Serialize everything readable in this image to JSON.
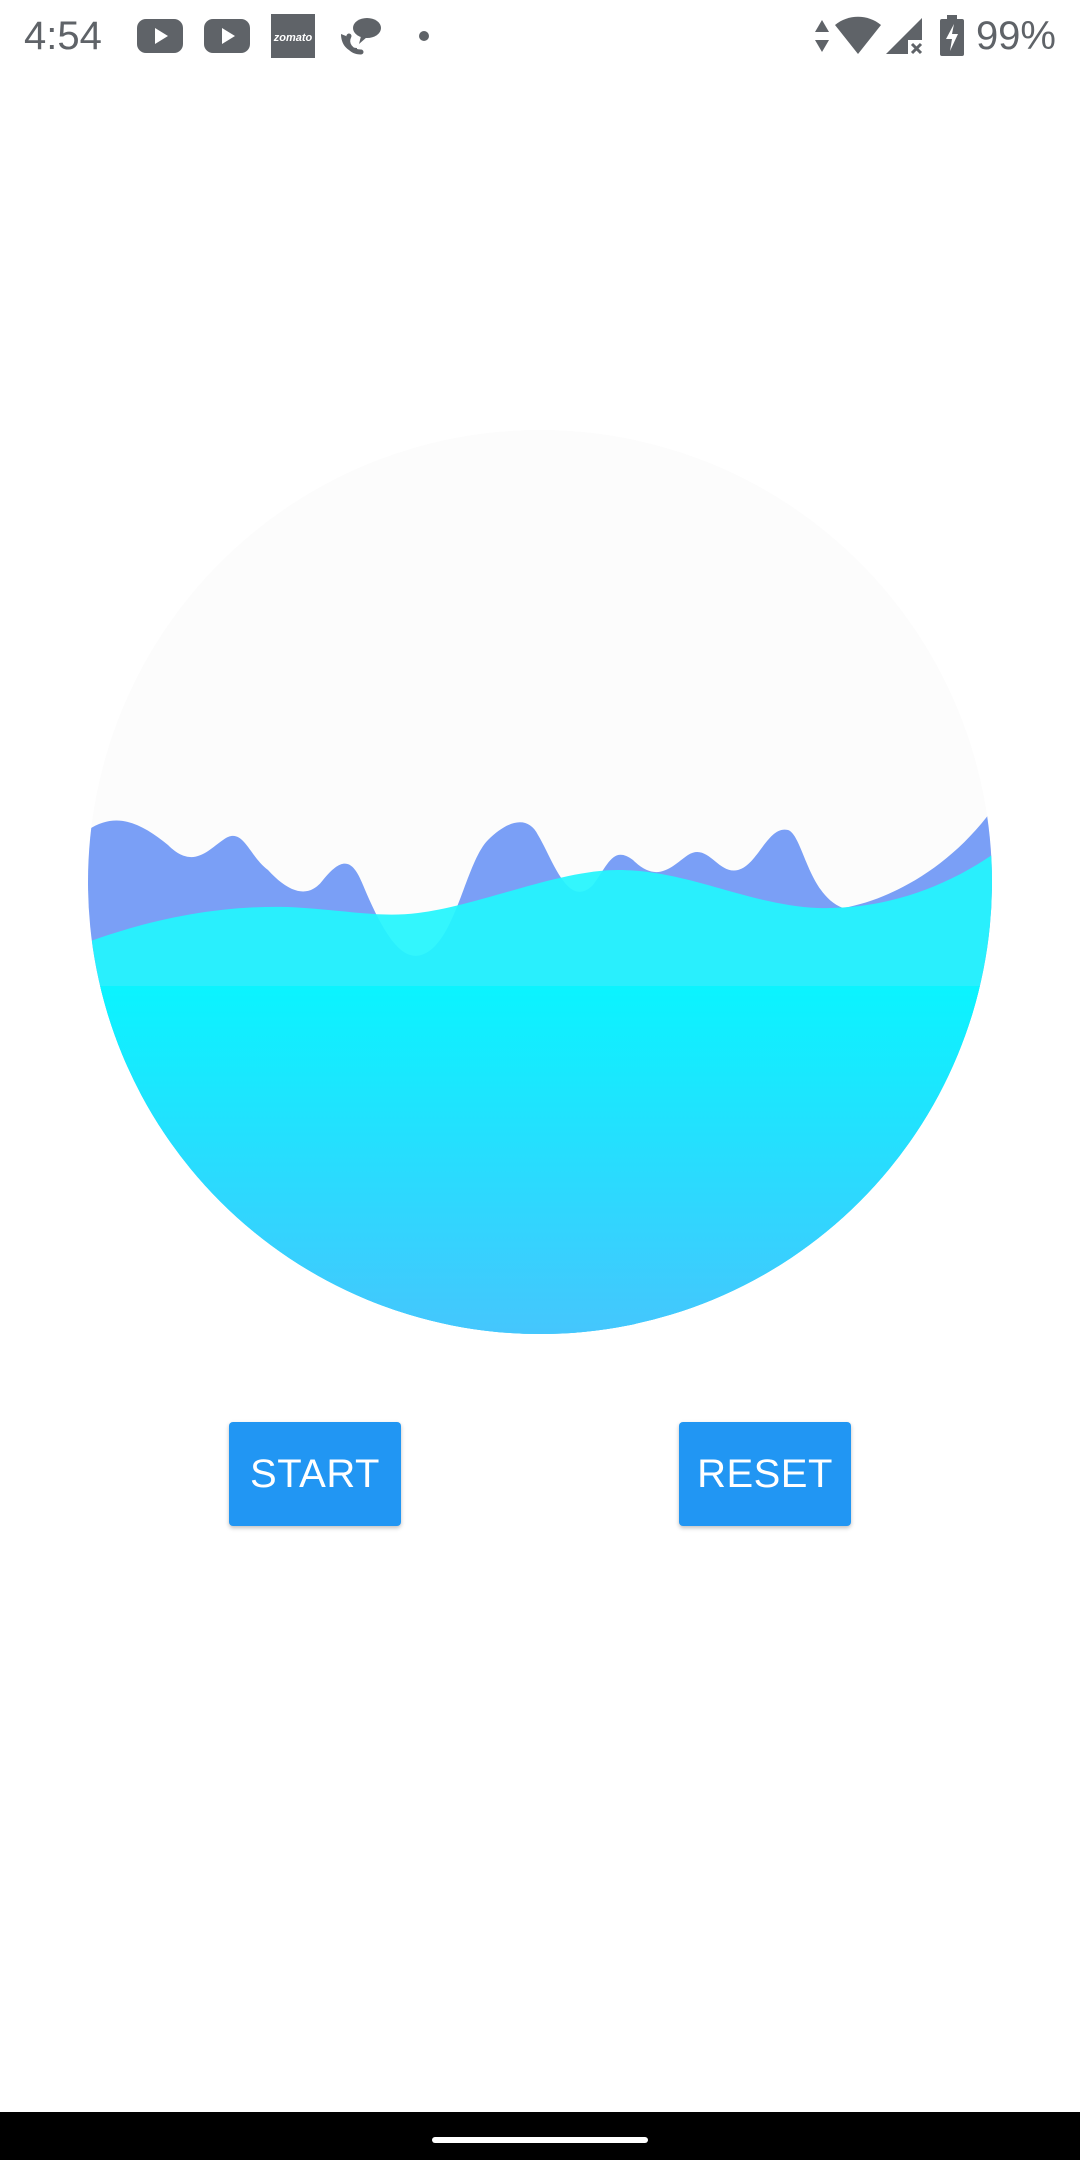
{
  "status_bar": {
    "time": "4:54",
    "icons": [
      "youtube-icon",
      "youtube-icon",
      "zomato-icon",
      "whatsapp-icon",
      "dot-icon"
    ],
    "zomato_label": "zomato",
    "right_icons": [
      "data-arrows-icon",
      "wifi-icon",
      "signal-no-service-icon",
      "battery-charging-icon"
    ],
    "battery": "99%"
  },
  "wave_view": {
    "fill_level": 0.5,
    "colors": {
      "background": "#fcfcfc",
      "back_wave": "#7a9ff6",
      "front_wave": "#22f5fd",
      "water_top": "#0af4ff",
      "water_bottom": "#45c6fd"
    }
  },
  "buttons": {
    "start_label": "START",
    "reset_label": "RESET",
    "color": "#2196f3"
  }
}
